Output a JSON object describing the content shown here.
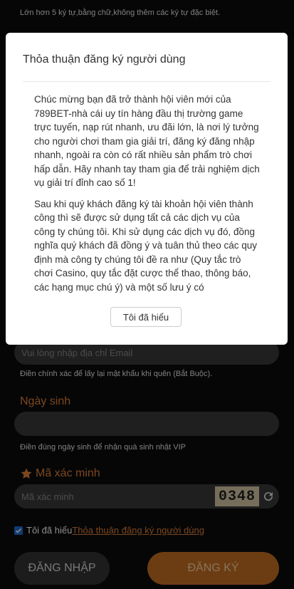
{
  "form": {
    "username_hint": "Lớn hơn 5 ký tự,bằng chữ,không thêm các ký tự đặc biệt.",
    "email_placeholder": "Vui lòng nhập địa chỉ Email",
    "email_hint": "Điền chính xác để lấy lại mật khẩu khi quên (Bắt Buộc).",
    "birthday_label": "Ngày sinh",
    "birthday_hint": "Điền đúng ngày sinh để nhận quà sinh nhật VIP",
    "captcha_label": "Mã xác minh",
    "captcha_placeholder": "Mã xác minh",
    "captcha_code": "0348",
    "agree_text": "Tôi đã hiểu",
    "agree_link": "Thỏa thuận đăng ký người dùng",
    "login_button": "ĐĂNG NHẬP",
    "register_button": "ĐĂNG KÝ"
  },
  "modal": {
    "title": "Thỏa thuận đăng ký người dùng",
    "paragraphs": [
      "Chúc mừng bạn đã trở thành hội viên mới của 789BET-nhà cái uy tín hàng đầu thị trường game trực tuyến, nạp rút nhanh, ưu đãi lớn, là nơi lý tưởng cho người chơi tham gia giải trí, đăng ký đăng nhập nhanh, ngoài ra còn có rất nhiều sản phẩm trò chơi hấp dẫn. Hãy nhanh tay tham gia để trải nghiệm dịch vụ giải trí đỉnh cao số 1!",
      "Sau khi quý khách đăng ký tài khoản hội viên thành công thì sẽ được sử dụng tất cả các dịch vụ của công ty chúng tôi. Khi sử dụng các dịch vụ đó, đồng nghĩa quý khách đã đồng ý và tuân thủ theo các quy định mà công ty chúng tôi đề ra như (Quy tắc trò chơi Casino, quy tắc đặt cược thể thao, thông báo, các hạng mục chú ý) và một số lưu ý có"
    ],
    "ok_button": "Tôi đã hiểu"
  },
  "colors": {
    "accent": "#e0823c",
    "register_bg": "#c56f24",
    "field_bg": "#3a3a3a"
  },
  "icons": {
    "star": "star-icon",
    "refresh": "refresh-icon",
    "checkbox": "check-icon"
  }
}
